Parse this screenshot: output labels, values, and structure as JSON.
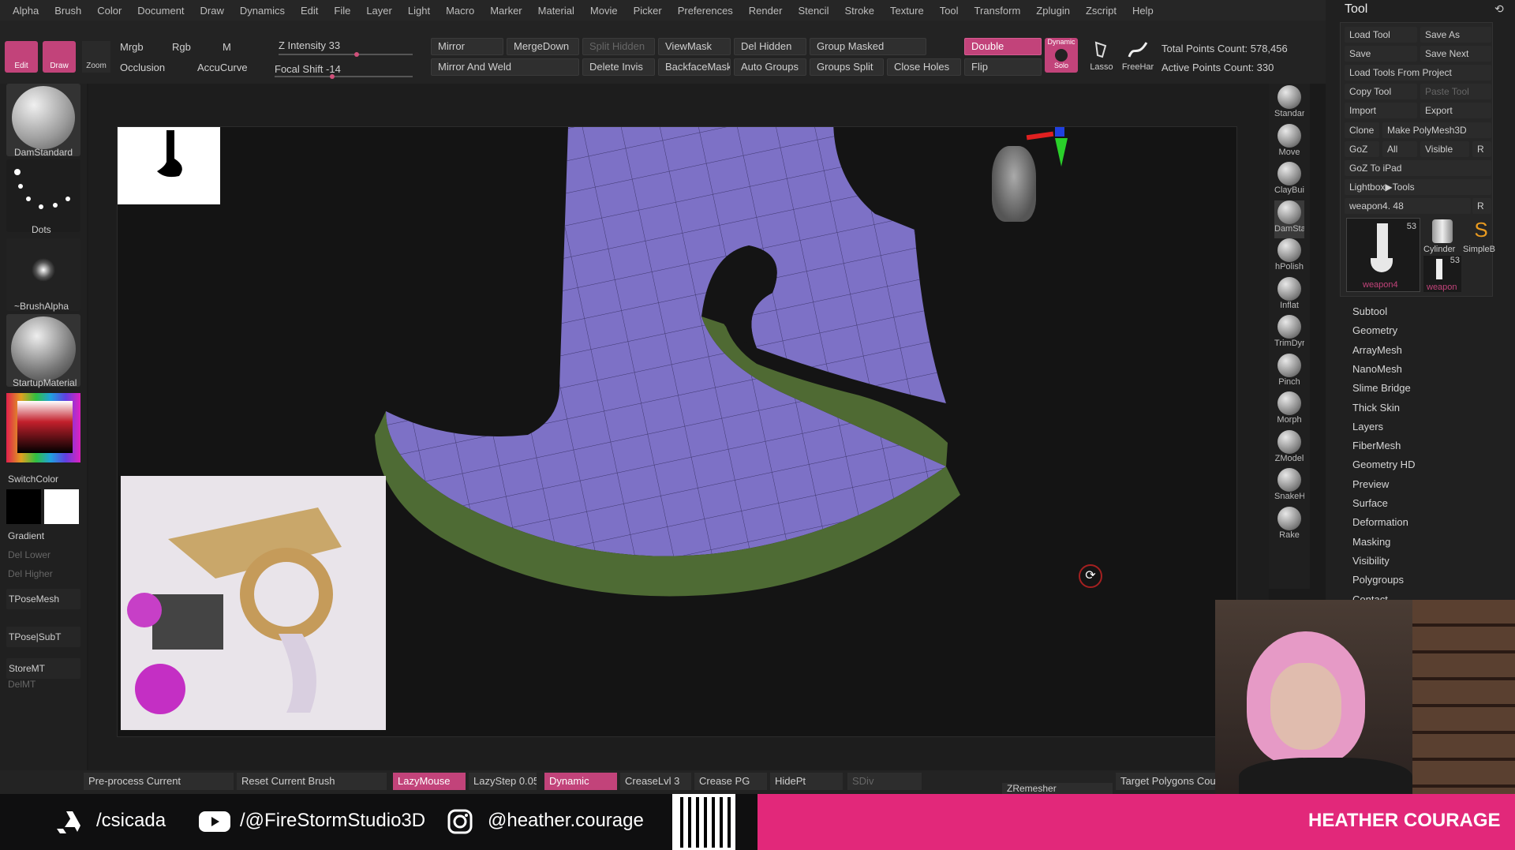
{
  "menu": [
    "Alpha",
    "Brush",
    "Color",
    "Document",
    "Draw",
    "Dynamics",
    "Edit",
    "File",
    "Layer",
    "Light",
    "Macro",
    "Marker",
    "Material",
    "Movie",
    "Picker",
    "Preferences",
    "Render",
    "Stencil",
    "Stroke",
    "Texture",
    "Tool",
    "Transform",
    "Zplugin",
    "Zscript",
    "Help"
  ],
  "shelf": {
    "edit": "Edit",
    "draw": "Draw",
    "zoom": "Zoom",
    "mrgb": "Mrgb",
    "rgb": "Rgb",
    "m": "M",
    "occlusion": "Occlusion",
    "accucurve": "AccuCurve",
    "z_intensity_label": "Z Intensity",
    "z_intensity_value": "33",
    "focal_shift_label": "Focal Shift",
    "focal_shift_value": "-14",
    "mirror": "Mirror",
    "mergedown": "MergeDown",
    "split_hidden": "Split Hidden",
    "viewmask": "ViewMask",
    "del_hidden": "Del Hidden",
    "group_masked": "Group Masked",
    "double": "Double",
    "dynamic": "Dynamic",
    "solo": "Solo",
    "lasso": "Lasso",
    "freehand": "FreeHar",
    "mirror_and_weld": "Mirror And Weld",
    "delete_invis": "Delete Invis",
    "backfacemask": "BackfaceMask",
    "auto_groups": "Auto Groups",
    "groups_split": "Groups Split",
    "close_holes": "Close Holes",
    "flip": "Flip",
    "total_points": "Total Points Count: 578,456",
    "active_points": "Active Points Count: 330"
  },
  "left": {
    "brush": "DamStandard",
    "stroke": "Dots",
    "alpha": "~BrushAlpha",
    "material": "StartupMaterial",
    "switchcolor": "SwitchColor",
    "gradient": "Gradient",
    "del_lower": "Del Lower",
    "del_higher": "Del Higher",
    "tposemesh": "TPoseMesh",
    "tpose_subt": "TPose|SubT",
    "storemt": "StoreMT",
    "delmt": "DelMT"
  },
  "brushes": [
    "Standar",
    "Move",
    "ClayBuil",
    "DamSta",
    "hPolish",
    "Inflat",
    "TrimDyr",
    "Pinch",
    "Morph",
    "ZModel",
    "SnakeH",
    "Rake"
  ],
  "tool": {
    "title": "Tool",
    "load_tool": "Load Tool",
    "save_as": "Save As",
    "save": "Save",
    "save_next": "Save Next",
    "load_from_project": "Load Tools From Project",
    "copy_tool": "Copy Tool",
    "paste_tool": "Paste Tool",
    "import": "Import",
    "export": "Export",
    "clone": "Clone",
    "make_polymesh": "Make PolyMesh3D",
    "goz": "GoZ",
    "all": "All",
    "visible": "Visible",
    "r": "R",
    "goz_ipad": "GoZ To iPad",
    "lightbox": "Lightbox▶Tools",
    "current_tool": "weapon4.",
    "current_value": "48",
    "thumb1_label": "weapon4",
    "thumb1_count": "53",
    "thumb2_label": "Cylinder",
    "thumb3_label": "SimpleB",
    "thumb4_label": "weapon",
    "thumb4_count": "53",
    "subpalettes": [
      "Subtool",
      "Geometry",
      "ArrayMesh",
      "NanoMesh",
      "Slime Bridge",
      "Thick Skin",
      "Layers",
      "FiberMesh",
      "Geometry HD",
      "Preview",
      "Surface",
      "Deformation",
      "Masking",
      "Visibility",
      "Polygroups",
      "Contact"
    ]
  },
  "bottom": {
    "preprocess": "Pre-process Current",
    "reset_brush": "Reset Current Brush",
    "lazymouse": "LazyMouse",
    "lazystep_label": "LazyStep",
    "lazystep_value": "0.05",
    "dynamic": "Dynamic",
    "creaselvl": "CreaseLvl 3",
    "crease_pg": "Crease PG",
    "hidept": "HidePt",
    "sdiv": "SDiv",
    "zremesher": "ZRemesher",
    "target_polys": "Target Polygons Cour"
  },
  "banner": {
    "artstation": "/csicada",
    "youtube": "/@FireStormStudio3D",
    "instagram": "@heather.courage",
    "name": "HEATHER COURAGE"
  },
  "colors": {
    "accent": "#c2437a",
    "mesh_face": "#7a6fc4",
    "mesh_edge": "#4e6b34",
    "banner_pink": "#e2287a"
  }
}
